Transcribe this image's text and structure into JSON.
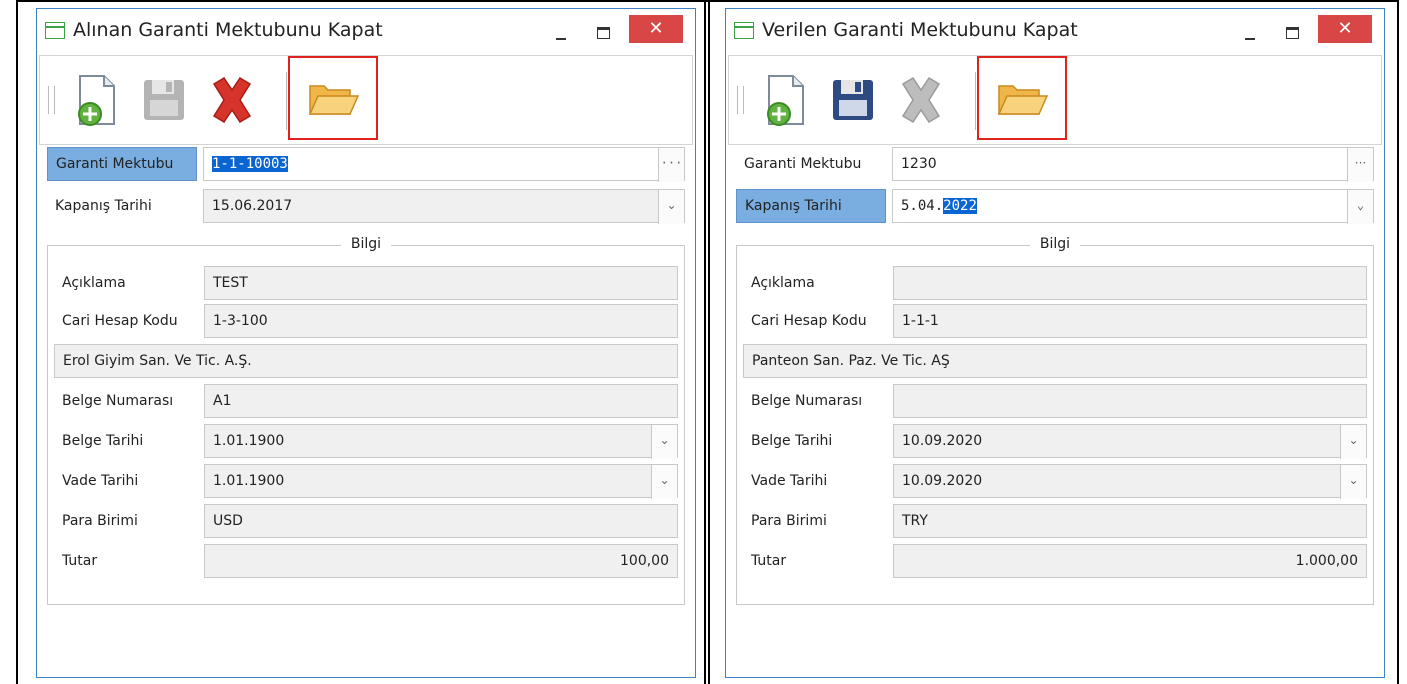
{
  "windows": [
    {
      "title": "Alınan Garanti Mektubunu Kapat",
      "close_label": "✕",
      "garanti_label": "Garanti Mektubu",
      "garanti_value": "1-1-10003",
      "kapanis_label": "Kapanış Tarihi",
      "kapanis_value": "15.06.2017",
      "group_title": "Bilgi",
      "aciklama_label": "Açıklama",
      "aciklama_value": "TEST",
      "cari_label": "Cari Hesap Kodu",
      "cari_value": "1-3-100",
      "cari_name": "Erol Giyim San. Ve Tic. A.Ş.",
      "belge_no_label": "Belge Numarası",
      "belge_no_value": "A1",
      "belge_tarihi_label": "Belge Tarihi",
      "belge_tarihi_value": "1.01.1900",
      "vade_label": "Vade Tarihi",
      "vade_value": "1.01.1900",
      "para_label": "Para Birimi",
      "para_value": "USD",
      "tutar_label": "Tutar",
      "tutar_value": "100,00",
      "ellipsis": "···",
      "chevron": "⌄"
    },
    {
      "title": "Verilen Garanti Mektubunu Kapat",
      "close_label": "✕",
      "garanti_label": "Garanti Mektubu",
      "garanti_value": "1230",
      "kapanis_label": "Kapanış Tarihi",
      "kapanis_prefix": "5.04.",
      "kapanis_selected": "2022",
      "group_title": "Bilgi",
      "aciklama_label": "Açıklama",
      "aciklama_value": "",
      "cari_label": "Cari Hesap Kodu",
      "cari_value": "1-1-1",
      "cari_name": "Panteon San. Paz. Ve Tic. AŞ",
      "belge_no_label": "Belge Numarası",
      "belge_no_value": "",
      "belge_tarihi_label": "Belge Tarihi",
      "belge_tarihi_value": "10.09.2020",
      "vade_label": "Vade Tarihi",
      "vade_value": "10.09.2020",
      "para_label": "Para Birimi",
      "para_value": "TRY",
      "tutar_label": "Tutar",
      "tutar_value": "1.000,00",
      "ellipsis": "···",
      "chevron": "⌄"
    }
  ],
  "colors": {
    "window_border": "#3c80c8",
    "close_red": "#d84646",
    "highlight_red": "#e0221f",
    "label_selected": "#7aaee0",
    "text_selected": "#0a64d2"
  }
}
